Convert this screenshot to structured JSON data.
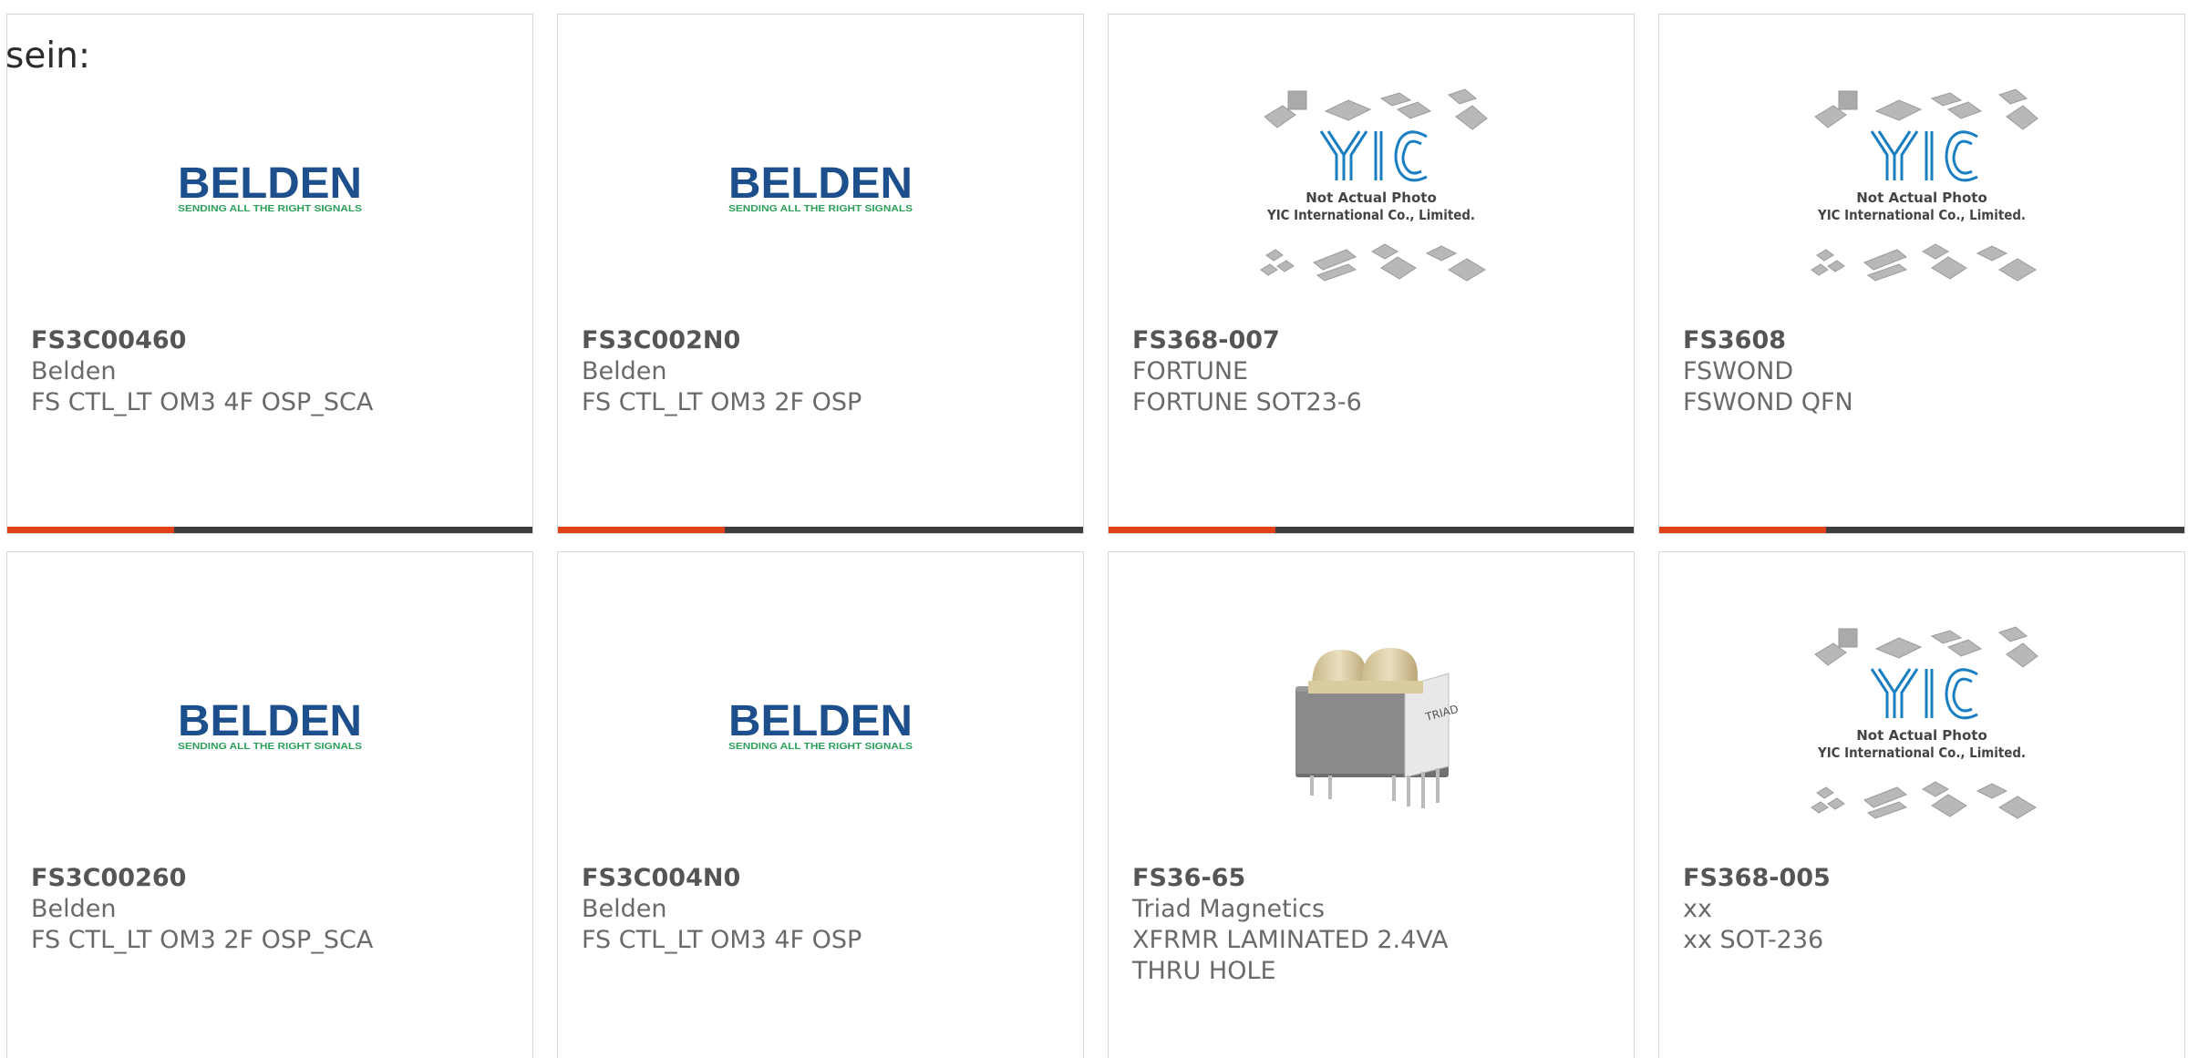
{
  "intro_text": "sein:",
  "colors": {
    "accent": "#e34017",
    "bar": "#3d3d3d",
    "belden_blue": "#1d4f8c",
    "belden_green": "#2aa05a",
    "yic_blue": "#1a7fc2"
  },
  "logos": {
    "belden": {
      "name": "BELDEN",
      "tagline": "SENDING ALL THE RIGHT SIGNALS"
    },
    "yic": {
      "name": "YIC",
      "line1": "Not Actual Photo",
      "line2": "YIC International Co., Limited."
    },
    "triad": {
      "label": "TRIAD"
    }
  },
  "products": [
    {
      "part_number": "FS3C00460",
      "manufacturer": "Belden",
      "description": "FS CTL_LT OM3 4F OSP_SCA",
      "image": "belden-logo"
    },
    {
      "part_number": "FS3C002N0",
      "manufacturer": "Belden",
      "description": "FS CTL_LT OM3 2F OSP",
      "image": "belden-logo"
    },
    {
      "part_number": "FS368-007",
      "manufacturer": "FORTUNE",
      "description": "FORTUNE SOT23-6",
      "image": "yic-not-actual-photo"
    },
    {
      "part_number": "FS3608",
      "manufacturer": "FSWOND",
      "description": "FSWOND QFN",
      "image": "yic-not-actual-photo"
    },
    {
      "part_number": "FS3C00260",
      "manufacturer": "Belden",
      "description": "FS CTL_LT OM3 2F OSP_SCA",
      "image": "belden-logo"
    },
    {
      "part_number": "FS3C004N0",
      "manufacturer": "Belden",
      "description": "FS CTL_LT OM3 4F OSP",
      "image": "belden-logo"
    },
    {
      "part_number": "FS36-65",
      "manufacturer": "Triad Magnetics",
      "description": "XFRMR LAMINATED 2.4VA THRU HOLE",
      "image": "transformer-photo"
    },
    {
      "part_number": "FS368-005",
      "manufacturer": "xx",
      "description": "xx SOT-236",
      "image": "yic-not-actual-photo"
    }
  ]
}
